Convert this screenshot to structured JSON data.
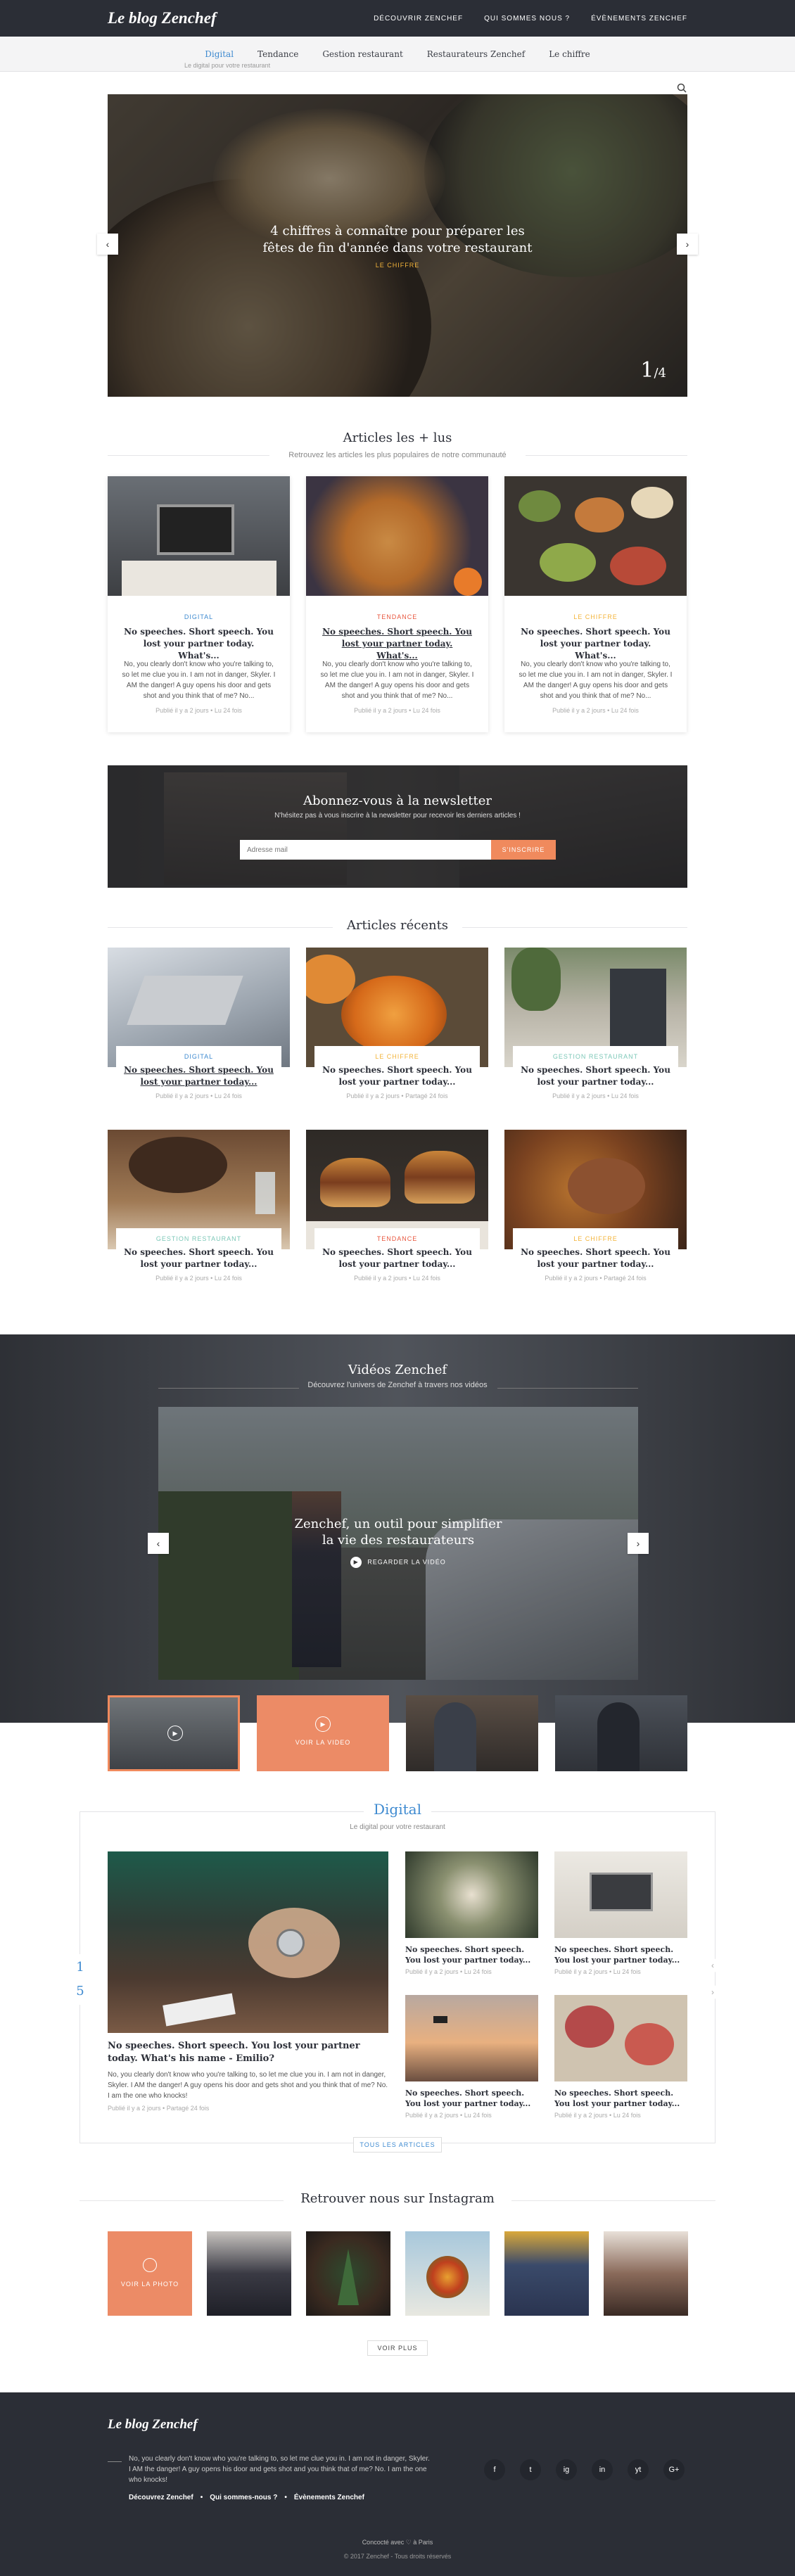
{
  "header": {
    "logo": "Le blog Zenchef",
    "nav": [
      "DÉCOUVRIR ZENCHEF",
      "QUI SOMMES NOUS ?",
      "ÉVÈNEMENTS ZENCHEF"
    ]
  },
  "categories": {
    "items": [
      "Digital",
      "Tendance",
      "Gestion restaurant",
      "Restaurateurs Zenchef",
      "Le chiffre"
    ],
    "active": "Digital",
    "active_sub": "Le digital pour votre restaurant"
  },
  "hero": {
    "title": "4 chiffres à connaître pour préparer les fêtes de fin d'année dans votre restaurant",
    "category": "LE CHIFFRE",
    "counter_current": "1",
    "counter_total": "/4"
  },
  "popular": {
    "title": "Articles les + lus",
    "subtitle": "Retrouvez les articles les plus populaires de notre communauté",
    "cards": [
      {
        "category": "DIGITAL",
        "title": "No speeches. Short speech. You lost your partner today. What's...",
        "text": "No, you clearly don't know who you're talking to, so let me clue you in. I am not in danger, Skyler. I AM the danger! A guy opens his door and gets shot and you think that of me? No...",
        "meta": "Publié il y a 2 jours • Lu 24 fois"
      },
      {
        "category": "TENDANCE",
        "title": "No speeches. Short speech. You lost your partner today. What's...",
        "text": "No, you clearly don't know who you're talking to, so let me clue you in. I am not in danger, Skyler. I AM the danger! A guy opens his door and gets shot and you think that of me? No...",
        "meta": "Publié il y a 2 jours • Lu 24 fois"
      },
      {
        "category": "LE CHIFFRE",
        "title": "No speeches. Short speech. You lost your partner today. What's...",
        "text": "No, you clearly don't know who you're talking to, so let me clue you in. I am not in danger, Skyler. I AM the danger! A guy opens his door and gets shot and you think that of me? No...",
        "meta": "Publié il y a 2 jours • Lu 24 fois"
      }
    ]
  },
  "newsletter": {
    "title": "Abonnez-vous à la newsletter",
    "subtitle": "N'hésitez pas à vous inscrire à la newsletter pour recevoir les derniers articles !",
    "placeholder": "Adresse mail",
    "button": "S'INSCRIRE"
  },
  "recent": {
    "title": "Articles récents",
    "cards": [
      {
        "category": "DIGITAL",
        "title": "No speeches. Short speech. You lost your partner today...",
        "meta": "Publié il y a 2 jours • Lu 24 fois"
      },
      {
        "category": "LE CHIFFRE",
        "title": "No speeches. Short speech. You lost your partner today...",
        "meta": "Publié il y a 2 jours • Partagé 24 fois"
      },
      {
        "category": "GESTION RESTAURANT",
        "title": "No speeches. Short speech. You lost your partner today...",
        "meta": "Publié il y a 2 jours • Lu 24 fois"
      },
      {
        "category": "GESTION RESTAURANT",
        "title": "No speeches. Short speech. You lost your partner today...",
        "meta": "Publié il y a 2 jours • Lu 24 fois"
      },
      {
        "category": "TENDANCE",
        "title": "No speeches. Short speech. You lost your partner today...",
        "meta": "Publié il y a 2 jours • Lu 24 fois"
      },
      {
        "category": "LE CHIFFRE",
        "title": "No speeches. Short speech. You lost your partner today...",
        "meta": "Publié il y a 2 jours • Partagé 24 fois"
      }
    ]
  },
  "videos": {
    "title": "Vidéos Zenchef",
    "subtitle": "Découvrez l'univers de Zenchef à travers nos vidéos",
    "main_title": "Zenchef, un outil pour simplifier la vie des restaurateurs",
    "watch": "REGARDER LA VIDÉO",
    "thumb_label": "VOIR LA VIDEO"
  },
  "digital": {
    "title": "Digital",
    "subtitle": "Le digital pour votre restaurant",
    "pager_current": "1",
    "pager_total": "5",
    "main": {
      "title": "No speeches. Short speech. You lost your partner today. What's his name - Emilio?",
      "text": "No, you clearly don't know who you're talking to, so let me clue you in. I am not in danger, Skyler. I AM the danger! A guy opens his door and gets shot and you think that of me? No. I am the one who knocks!",
      "meta": "Publié il y a 2 jours • Partagé 24 fois"
    },
    "items": [
      {
        "title": "No speeches. Short speech. You lost your partner today...",
        "meta": "Publié il y a 2 jours • Lu 24 fois"
      },
      {
        "title": "No speeches. Short speech. You lost your partner today...",
        "meta": "Publié il y a 2 jours • Lu 24 fois"
      },
      {
        "title": "No speeches. Short speech. You lost your partner today...",
        "meta": "Publié il y a 2 jours • Lu 24 fois"
      },
      {
        "title": "No speeches. Short speech. You lost your partner today...",
        "meta": "Publié il y a 2 jours • Lu 24 fois"
      }
    ],
    "all_button": "TOUS LES ARTICLES"
  },
  "instagram": {
    "title": "Retrouver nous sur Instagram",
    "photo_label": "VOIR LA PHOTO",
    "more_button": "VOIR PLUS"
  },
  "footer": {
    "logo": "Le blog Zenchef",
    "text": "No, you clearly don't know who you're talking to, so let me clue you in. I am not in danger, Skyler. I AM the danger! A guy opens his door and gets shot and you think that of me? No. I am the one who knocks!",
    "links": [
      "Découvrez Zenchef",
      "Qui sommes-nous ?",
      "Évènements Zenchef"
    ],
    "social": [
      "f",
      "t",
      "ig",
      "in",
      "yt",
      "G+"
    ],
    "credit": "Concocté avec ♡ à Paris",
    "copyright": "© 2017 Zenchef - Tous droits réservés"
  },
  "colors": {
    "dark": "#2b2e36",
    "accent_blue": "#3e8ad0",
    "digital": "#3e8ad0",
    "tendance": "#e8573f",
    "chiffre": "#f3b43a",
    "gestion": "#7dc8b8",
    "orange": "#f08a5d"
  }
}
